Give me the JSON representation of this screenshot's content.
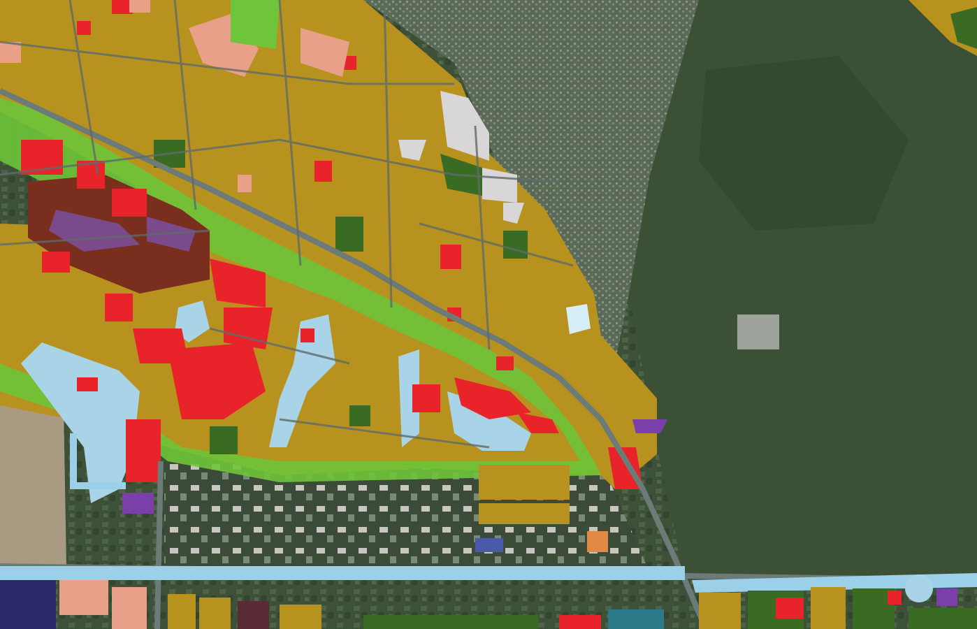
{
  "map": {
    "basemap": "satellite-imagery",
    "overlay": "land-use-zoning-plan",
    "colors": {
      "residential": "#b8921e",
      "commercial": "#e8232a",
      "mixed_use_dark": "#7a2e1e",
      "institutional": "#7a4a8a",
      "park_green": "#6ec43a",
      "forest_green": "#3a6b22",
      "water": "#a9d3e6",
      "industrial_light": "#d9d6d8",
      "pink_landuse": "#e8a088",
      "road": "#6c7a78",
      "canal_blue": "#9ccfe8",
      "purple_utility": "#7a3fa8",
      "orange_parcel": "#e08a45",
      "dark_maroon": "#5a2a35",
      "teal": "#2a7a8a",
      "navy": "#2a2a6a",
      "satellite_dark": "#2f4330",
      "satellite_mid": "#4a5d44",
      "satellite_light": "#6b7a60"
    }
  }
}
